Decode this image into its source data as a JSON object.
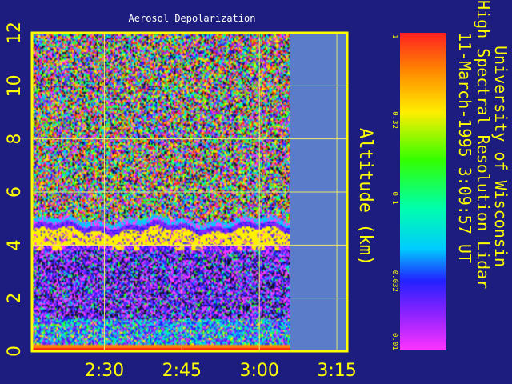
{
  "chart_data": {
    "type": "heatmap",
    "title": "Aerosol Depolarization",
    "ylabel": "Altitude (km)",
    "y_ticks": [
      "0",
      "2",
      "4",
      "6",
      "8",
      "10",
      "12"
    ],
    "ylim": [
      0,
      12
    ],
    "x_ticks": [
      "2:30",
      "2:45",
      "3:00",
      "3:15"
    ],
    "x_tick_minutes": [
      150,
      165,
      180,
      195
    ],
    "xlim_minutes": [
      136,
      197
    ],
    "data_end_minutes": [
      186
    ],
    "colorbar": {
      "scale": "log",
      "range": [
        0.01,
        1
      ],
      "ticks": [
        "1",
        "0.32",
        "0.1",
        "0.032",
        "0.01"
      ],
      "tick_values": [
        1,
        0.32,
        0.1,
        0.032,
        0.01
      ]
    },
    "features": [
      {
        "name": "aerosol layer top",
        "altitude_km": 4.7
      },
      {
        "name": "high-depolarization band",
        "altitude_km_range": [
          3.7,
          4.5
        ]
      },
      {
        "name": "surface layer",
        "altitude_km_range": [
          0,
          0.3
        ]
      }
    ],
    "grid": true
  },
  "side_text": {
    "line1": "University of Wisconsin",
    "line2": "High Spectral Resolution Lidar",
    "line3": "11-March-1995   3:09:57 UT"
  },
  "colors": {
    "background": "#1d1d7f",
    "axis": "#ffff00",
    "no_data": "#5b7cc9"
  }
}
